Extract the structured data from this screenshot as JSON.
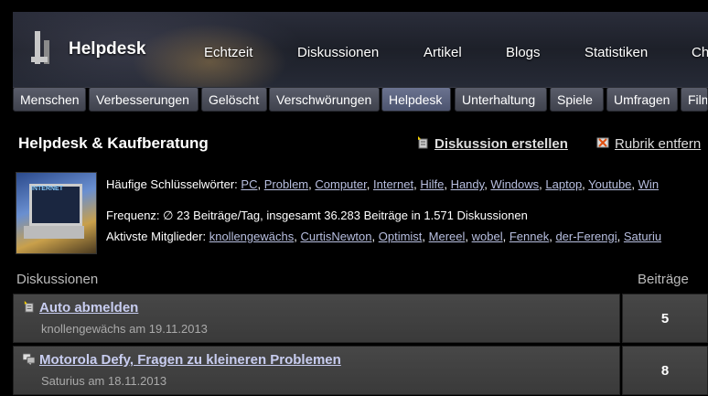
{
  "header": {
    "brand": "Helpdesk",
    "nav": [
      "Echtzeit",
      "Diskussionen",
      "Artikel",
      "Blogs",
      "Statistiken",
      "Ch"
    ]
  },
  "categories": [
    {
      "label": "Menschen",
      "active": false
    },
    {
      "label": "Verbesserungen",
      "active": false
    },
    {
      "label": "Gelöscht",
      "active": false
    },
    {
      "label": "Verschwörungen",
      "active": false
    },
    {
      "label": "Helpdesk",
      "active": true
    },
    {
      "label": "Unterhaltung",
      "active": false
    },
    {
      "label": "Spiele",
      "active": false
    },
    {
      "label": "Umfragen",
      "active": false
    },
    {
      "label": "Film",
      "active": false
    }
  ],
  "page": {
    "title": "Helpdesk & Kaufberatung",
    "create_label": "Diskussion erstellen",
    "remove_label": "Rubrik entfern"
  },
  "info": {
    "keywords_label": "Häufige Schlüsselwörter:",
    "keywords": [
      "PC",
      "Problem",
      "Computer",
      "Internet",
      "Hilfe",
      "Handy",
      "Windows",
      "Laptop",
      "Youtube",
      "Win"
    ],
    "frequency": "Frequenz: ∅ 23 Beiträge/Tag, insgesamt 36.283 Beiträge in 1.571 Diskussionen",
    "members_label": "Aktivste Mitglieder:",
    "members": [
      "knollengewächs",
      "CurtisNewton",
      "Optimist",
      "Mereel",
      "wobel",
      "Fennek",
      "der-Ferengi",
      "Saturiu"
    ]
  },
  "table": {
    "col_discussions": "Diskussionen",
    "col_posts": "Beiträge",
    "rows": [
      {
        "title": "Auto abmelden",
        "author": "knollengewächs",
        "date_text": "am 19.11.2013",
        "posts": "5",
        "icon": "new-topic-icon"
      },
      {
        "title": "Motorola Defy, Fragen zu kleineren Problemen",
        "author": "Saturius",
        "date_text": "am 18.11.2013",
        "posts": "8",
        "icon": "chat-bubbles-icon"
      }
    ]
  },
  "colors": {
    "accent_link": "#b8bfe0",
    "topic_link": "#c8cdf0",
    "active_tab": "#5a6280"
  }
}
